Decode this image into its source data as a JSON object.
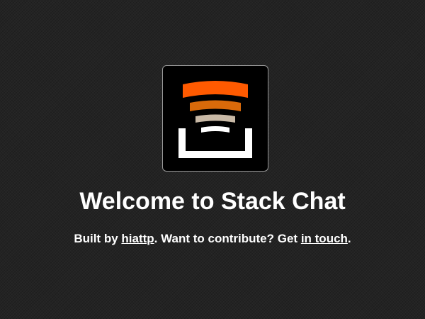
{
  "logo": {
    "name": "stack-chat-logo",
    "colors": {
      "bar_top": "#ff5a00",
      "bar_second": "#d96a0a",
      "bar_third": "#c8b9a6",
      "bar_fourth": "#ffffff",
      "tray": "#ffffff",
      "background": "#000000"
    }
  },
  "welcome": {
    "title": "Welcome to Stack Chat"
  },
  "tagline": {
    "prefix": "Built by ",
    "author_link": "hiattp",
    "middle": ". Want to contribute? Get ",
    "contact_link": "in touch",
    "suffix": "."
  }
}
